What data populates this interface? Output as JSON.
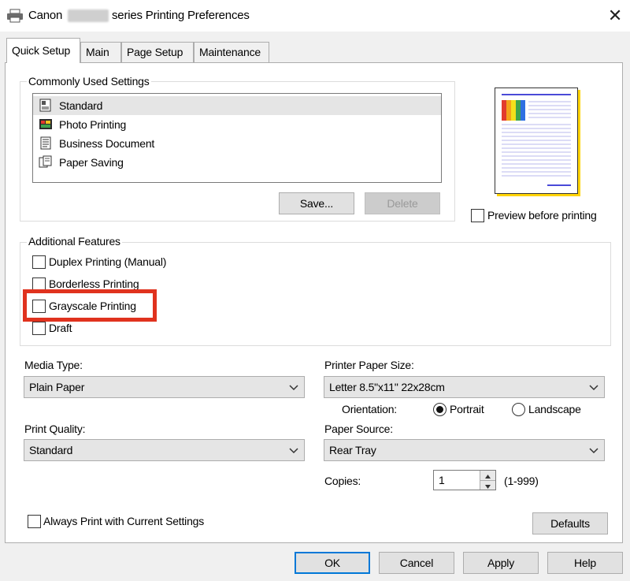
{
  "window": {
    "title_prefix": "Canon",
    "title_suffix": "series Printing Preferences",
    "close_glyph": "✕"
  },
  "tabs": [
    {
      "label": "Quick Setup",
      "active": true
    },
    {
      "label": "Main",
      "active": false
    },
    {
      "label": "Page Setup",
      "active": false
    },
    {
      "label": "Maintenance",
      "active": false
    }
  ],
  "commonly_used": {
    "legend": "Commonly Used Settings",
    "items": [
      {
        "label": "Standard",
        "icon": "standard-icon",
        "selected": true
      },
      {
        "label": "Photo Printing",
        "icon": "photo-icon",
        "selected": false
      },
      {
        "label": "Business Document",
        "icon": "document-icon",
        "selected": false
      },
      {
        "label": "Paper Saving",
        "icon": "paper-saving-icon",
        "selected": false
      }
    ],
    "save_label": "Save...",
    "delete_label": "Delete"
  },
  "preview": {
    "checkbox_label": "Preview before printing",
    "checked": false
  },
  "additional_features": {
    "legend": "Additional Features",
    "items": [
      {
        "label": "Duplex Printing (Manual)",
        "checked": false
      },
      {
        "label": "Borderless Printing",
        "checked": false
      },
      {
        "label": "Grayscale Printing",
        "checked": false,
        "highlighted": true
      },
      {
        "label": "Draft",
        "checked": false
      }
    ],
    "highlight_color": "#e0321e"
  },
  "media_type": {
    "label": "Media Type:",
    "value": "Plain Paper"
  },
  "paper_size": {
    "label": "Printer Paper Size:",
    "value": "Letter 8.5\"x11\" 22x28cm"
  },
  "orientation": {
    "label": "Orientation:",
    "portrait_label": "Portrait",
    "landscape_label": "Landscape",
    "selected": "Portrait"
  },
  "print_quality": {
    "label": "Print Quality:",
    "value": "Standard"
  },
  "paper_source": {
    "label": "Paper Source:",
    "value": "Rear Tray"
  },
  "copies": {
    "label": "Copies:",
    "value": "1",
    "range": "(1-999)"
  },
  "always_print": {
    "label": "Always Print with Current Settings",
    "checked": false
  },
  "defaults_label": "Defaults",
  "footer": {
    "ok": "OK",
    "cancel": "Cancel",
    "apply": "Apply",
    "help": "Help"
  },
  "colors": {
    "accent": "#0078d7",
    "window_bg": "#f0f0f0",
    "panel_bg": "#ffffff"
  }
}
